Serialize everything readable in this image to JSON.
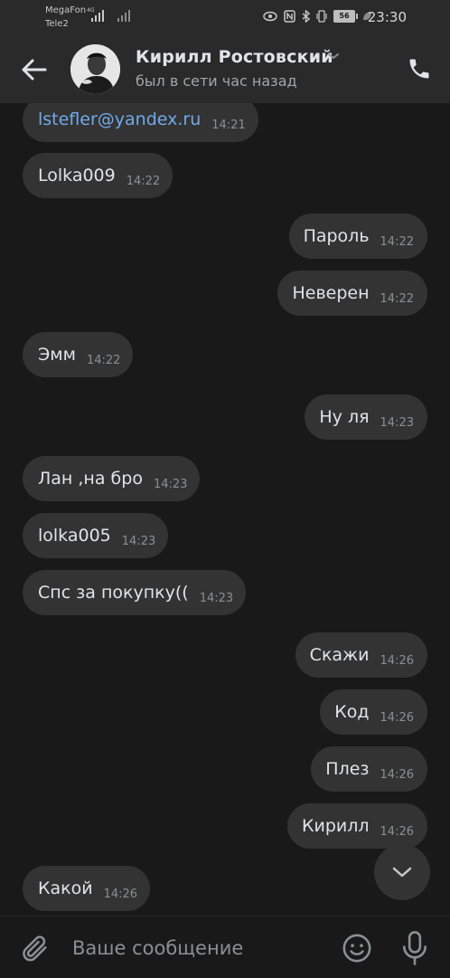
{
  "status_bar": {
    "carrier1": "MegaFon",
    "carrier2": "Tele2",
    "network": "4G",
    "battery": "56",
    "time": "23:30"
  },
  "header": {
    "contact_name": "Кирилл Ростовский",
    "status": "был в сети час назад",
    "icons": {
      "back": "arrow-left-icon",
      "call": "phone-icon",
      "menu": "chevron-down-icon"
    }
  },
  "messages": [
    {
      "dir": "in",
      "text": "lstefler@yandex.ru",
      "time": "14:21",
      "link": true
    },
    {
      "dir": "in",
      "text": "Lolka009",
      "time": "14:22"
    },
    {
      "dir": "out",
      "text": "Пароль",
      "time": "14:22"
    },
    {
      "dir": "out",
      "text": "Неверен",
      "time": "14:22"
    },
    {
      "dir": "in",
      "text": "Эмм",
      "time": "14:22"
    },
    {
      "dir": "out",
      "text": "Ну ля",
      "time": "14:23"
    },
    {
      "dir": "in",
      "text": "Лан ,на бро",
      "time": "14:23"
    },
    {
      "dir": "in",
      "text": "lolka005",
      "time": "14:23"
    },
    {
      "dir": "in",
      "text": "Спс за покупку((",
      "time": "14:23"
    },
    {
      "dir": "out",
      "text": "Скажи",
      "time": "14:26"
    },
    {
      "dir": "out",
      "text": "Код",
      "time": "14:26"
    },
    {
      "dir": "out",
      "text": "Плез",
      "time": "14:26"
    },
    {
      "dir": "out",
      "text": "Кирилл",
      "time": "14:26"
    },
    {
      "dir": "in",
      "text": "Какой",
      "time": "14:26"
    }
  ],
  "composer": {
    "placeholder": "Ваше сообщение",
    "icons": {
      "attach": "paperclip-icon",
      "emoji": "emoji-icon",
      "mic": "microphone-icon"
    }
  },
  "colors": {
    "background": "#191919",
    "bubble": "#333333",
    "header": "#2a2a2a",
    "link": "#71aaeb"
  }
}
